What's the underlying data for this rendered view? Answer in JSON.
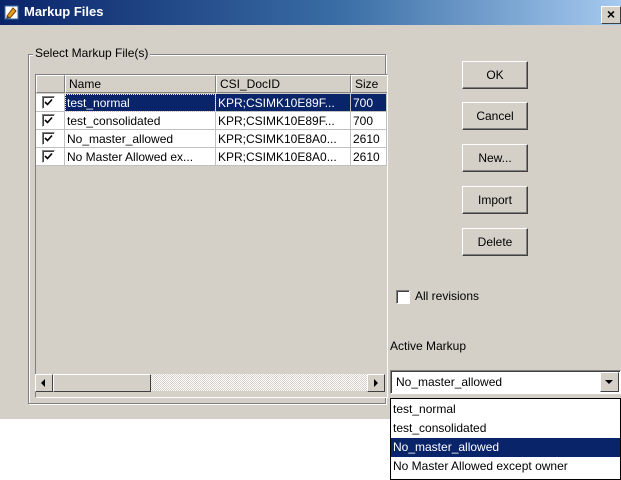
{
  "window": {
    "title": "Markup Files",
    "close_glyph": "×"
  },
  "group": {
    "label": "Select Markup File(s)"
  },
  "table": {
    "columns": [
      "Name",
      "CSI_DocID",
      "Size"
    ],
    "rows": [
      {
        "name": "test_normal",
        "doc_id": "KPR;CSIMK10E89F...",
        "size": "700",
        "checked": true,
        "selected": true
      },
      {
        "name": "test_consolidated",
        "doc_id": "KPR;CSIMK10E89F...",
        "size": "700",
        "checked": true,
        "selected": false
      },
      {
        "name": "No_master_allowed",
        "doc_id": "KPR;CSIMK10E8A0...",
        "size": "2610",
        "checked": true,
        "selected": false
      },
      {
        "name": "No Master Allowed ex...",
        "doc_id": "KPR;CSIMK10E8A0...",
        "size": "2610",
        "checked": true,
        "selected": false
      }
    ]
  },
  "buttons": {
    "ok": "OK",
    "cancel": "Cancel",
    "new": "New...",
    "import": "Import",
    "delete": "Delete"
  },
  "all_revisions": {
    "label": "All revisions",
    "checked": false
  },
  "active_markup": {
    "label": "Active Markup",
    "selected": "No_master_allowed",
    "options": [
      "test_normal",
      "test_consolidated",
      "No_master_allowed",
      "No Master Allowed except owner"
    ]
  },
  "colors": {
    "selection": "#0a246a",
    "dialog_bg": "#d4d0c8"
  }
}
